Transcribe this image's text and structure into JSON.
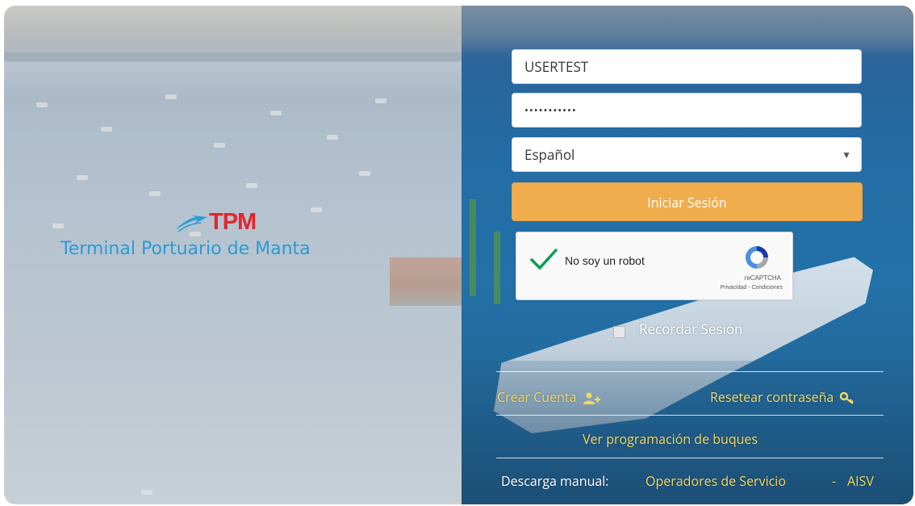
{
  "brand": {
    "logo_short": "TPM",
    "logo_name": "Terminal Portuario de Manta"
  },
  "form": {
    "username_value": "USERTEST",
    "password_value": "•••••••••••",
    "language_selected": "Español",
    "login_button": "Iniciar Sesión",
    "remember_label": "Recordar Sesión"
  },
  "captcha": {
    "label": "No soy un robot",
    "brand": "reCAPTCHA",
    "terms": "Privacidad - Condiciones"
  },
  "links": {
    "create_account": "Crear Cuenta",
    "reset_password": "Resetear contraseña",
    "ship_schedule": "Ver programación de buques",
    "manual_label": "Descarga manual:",
    "manual_operators": "Operadores de Servicio",
    "separator": "-",
    "manual_aisv": "AISV"
  },
  "colors": {
    "login_button_bg": "#f0ad4e",
    "link_color": "#f5d860",
    "logo_red": "#e2262d",
    "logo_blue": "#2a9bd6"
  },
  "icons": [
    "user-add-icon",
    "key-icon",
    "checkmark-icon",
    "recaptcha-icon",
    "dropdown-arrow-icon"
  ]
}
